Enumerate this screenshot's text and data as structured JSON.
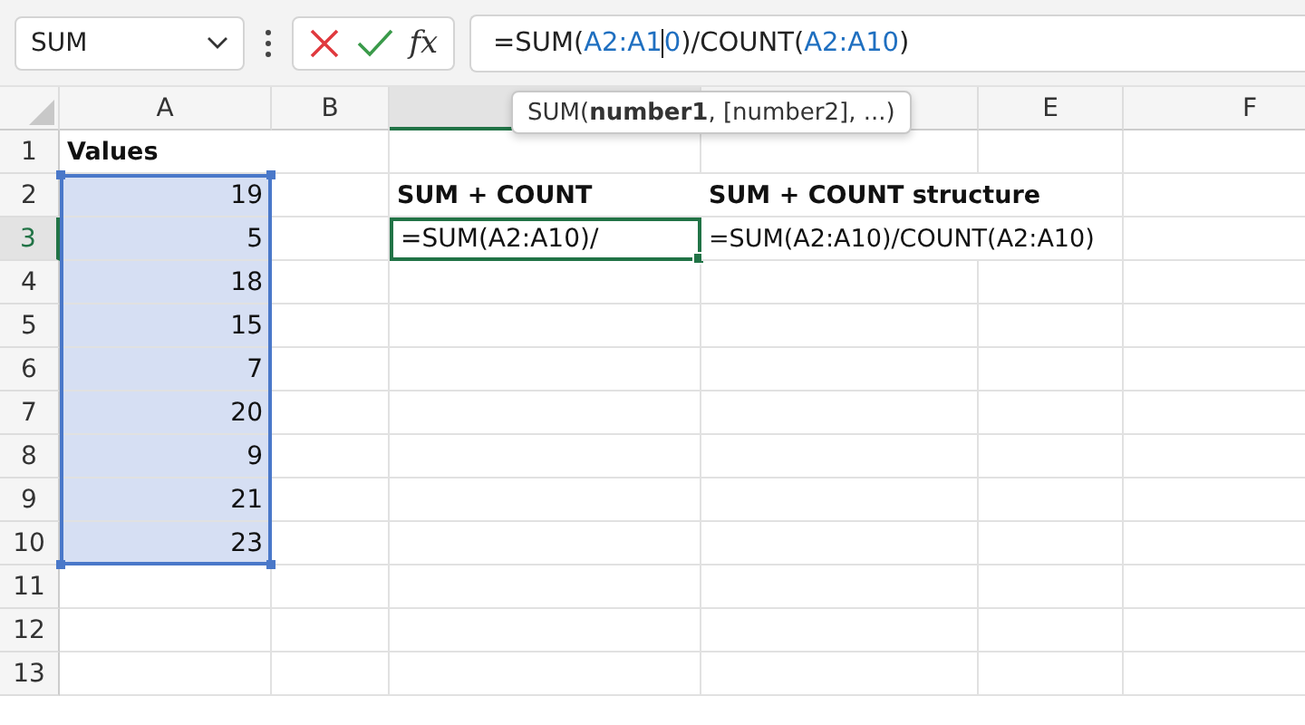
{
  "name_box": {
    "value": "SUM"
  },
  "function_button": "fx",
  "formula_bar": {
    "segments": [
      {
        "text": "=SUM(",
        "kind": "plain"
      },
      {
        "text": "A2:A1",
        "kind": "ref"
      },
      {
        "text": "0",
        "kind": "ref",
        "caret": true
      },
      {
        "text": ")/COUNT(",
        "kind": "plain"
      },
      {
        "text": "A2:A10",
        "kind": "ref"
      },
      {
        "text": ")",
        "kind": "plain"
      }
    ]
  },
  "tooltip": {
    "text": "SUM(**number1**, [number2], ...)"
  },
  "columns": [
    {
      "label": "A",
      "selected": false
    },
    {
      "label": "B",
      "selected": false
    },
    {
      "selected": true
    },
    {
      "selected": false
    },
    {
      "label": "E",
      "selected": false
    },
    {
      "label": "F",
      "selected": false
    }
  ],
  "row_numbers": [
    {
      "label": "1",
      "selected": false
    },
    {
      "label": "2",
      "selected": false
    },
    {
      "label": "3",
      "selected": true
    },
    {
      "label": "4",
      "selected": false
    },
    {
      "label": "5",
      "selected": false
    },
    {
      "label": "6",
      "selected": false
    },
    {
      "label": "7",
      "selected": false
    },
    {
      "label": "8",
      "selected": false
    },
    {
      "label": "9",
      "selected": false
    },
    {
      "label": "10",
      "selected": false
    },
    {
      "label": "11",
      "selected": false
    },
    {
      "label": "12",
      "selected": false
    },
    {
      "label": "13",
      "selected": false
    }
  ],
  "values_column": {
    "header": "Values",
    "selected": true,
    "items": [
      "19",
      "5",
      "18",
      "15",
      "7",
      "20",
      "9",
      "21",
      "23"
    ]
  },
  "sum_count": {
    "header": "SUM + COUNT",
    "editing_value": "=SUM(A2:A10)/"
  },
  "structure": {
    "header": "SUM + COUNT structure",
    "formula": "=SUM(A2:A10)/COUNT(A2:A10)"
  }
}
